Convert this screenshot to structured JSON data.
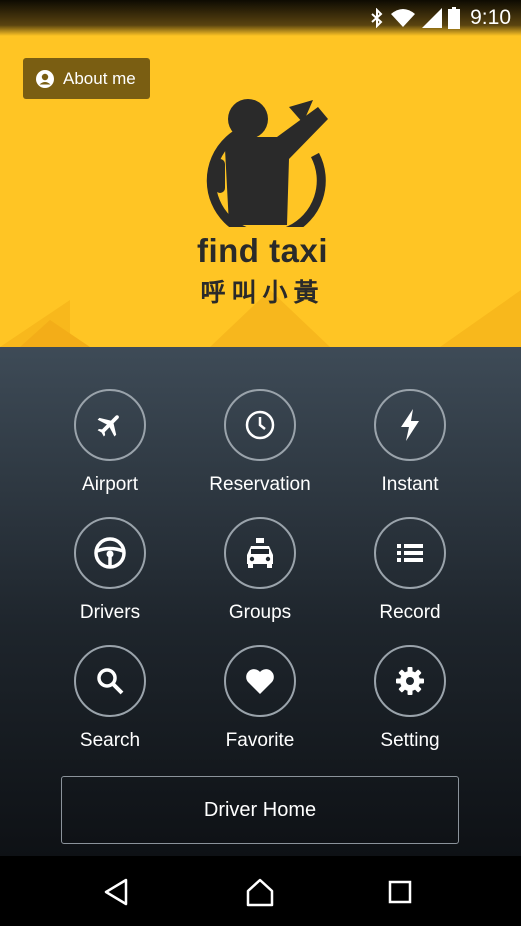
{
  "status_bar": {
    "time": "9:10",
    "icons": [
      "bluetooth-icon",
      "wifi-icon",
      "signal-icon",
      "battery-icon"
    ]
  },
  "header": {
    "about_button": {
      "label": "About me",
      "icon": "account-circle-icon"
    },
    "logo": {
      "text_en": "find taxi",
      "text_zh": "呼叫小黃",
      "icon": "hailing-person-logo"
    },
    "colors": {
      "background": "#ffc524",
      "button": "#7a5e12"
    }
  },
  "menu": {
    "items": [
      {
        "label": "Airport",
        "icon": "airplane-icon"
      },
      {
        "label": "Reservation",
        "icon": "clock-icon"
      },
      {
        "label": "Instant",
        "icon": "lightning-icon"
      },
      {
        "label": "Drivers",
        "icon": "steering-wheel-icon"
      },
      {
        "label": "Groups",
        "icon": "taxi-icon"
      },
      {
        "label": "Record",
        "icon": "list-icon"
      },
      {
        "label": "Search",
        "icon": "search-icon"
      },
      {
        "label": "Favorite",
        "icon": "heart-icon"
      },
      {
        "label": "Setting",
        "icon": "gear-icon"
      }
    ],
    "driver_home_label": "Driver Home"
  },
  "nav_bar": {
    "icons": [
      "back-icon",
      "home-icon",
      "recents-icon"
    ]
  }
}
